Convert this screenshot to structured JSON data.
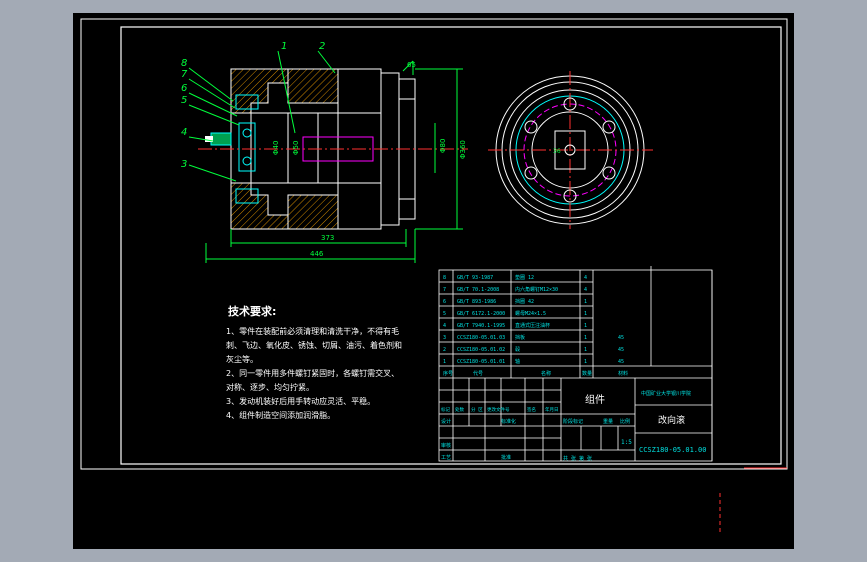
{
  "colors": {
    "background": "#000000",
    "border": "#ffffff",
    "dimension": "#00ff3c",
    "hatch": "#ffa500",
    "centerline": "#ff00ff",
    "parts_outline": "#00ffff"
  },
  "balloons": [
    "1",
    "2",
    "3",
    "4",
    "5",
    "6",
    "7",
    "8"
  ],
  "dimensions": {
    "d_top": "65",
    "d_small": "Φ80",
    "d_large": "Φ360",
    "len_inner": "373",
    "len_total": "446",
    "side_view_small": "36"
  },
  "tech_requirements": {
    "title": "技术要求:",
    "lines": [
      "1、零件在装配前必须清理和清洗干净，不得有毛",
      "刺、飞边、氧化皮、锈蚀、切屑、油污、着色剂和",
      "灰尘等。",
      "2、同一零件用多件螺钉紧固时，各螺钉需交叉、",
      "对称、逐步、均匀拧紧。",
      "3、发动机装好后用手转动应灵活、平稳。",
      "4、组件制造空间添加润滑脂。"
    ]
  },
  "bom_rows": [
    {
      "no": "8",
      "std": "GB/T 93-1987",
      "name": "垫圈 12",
      "qty": "4",
      "mat": ""
    },
    {
      "no": "7",
      "std": "GB/T 70.1-2008",
      "name": "内六角螺钉M12×30",
      "qty": "4",
      "mat": ""
    },
    {
      "no": "6",
      "std": "GB/T 893-1986",
      "name": "挡圈 42",
      "qty": "1",
      "mat": ""
    },
    {
      "no": "5",
      "std": "GB/T 6172.1-2000",
      "name": "螺母M24×1.5",
      "qty": "1",
      "mat": ""
    },
    {
      "no": "4",
      "std": "GB/T 7940.1-1995",
      "name": "直通式压注油杯",
      "qty": "1",
      "mat": ""
    },
    {
      "no": "3",
      "std": "CCSZ180-05.01.03",
      "name": "挡板",
      "qty": "1",
      "mat": "45"
    },
    {
      "no": "2",
      "std": "CCSZ180-05.01.02",
      "name": "毂",
      "qty": "1",
      "mat": "45"
    },
    {
      "no": "1",
      "std": "CCSZ180-05.01.01",
      "name": "轴",
      "qty": "1",
      "mat": "45"
    }
  ],
  "title_block": {
    "header_no": "序号",
    "header_code": "代号",
    "header_name": "名称",
    "header_qty": "数量",
    "header_mat": "材料",
    "assembly_name": "组件",
    "school": "中国矿业大学银川学院",
    "drawing_title": "改向滚",
    "drawing_number": "CCSZ180-05.01.00",
    "scale": "1:5",
    "sheet_info": "共 张 第 张",
    "stage_label": "阶段标记",
    "weight_label": "重量",
    "scale_label": "比例",
    "row_labels": [
      "标记",
      "处数",
      "分 区",
      "更改文件号",
      "签名",
      "年月日"
    ],
    "role_designer": "设计",
    "role_standard": "标准化",
    "role_checker": "审核",
    "role_process": "工艺",
    "role_approve": "批准"
  }
}
